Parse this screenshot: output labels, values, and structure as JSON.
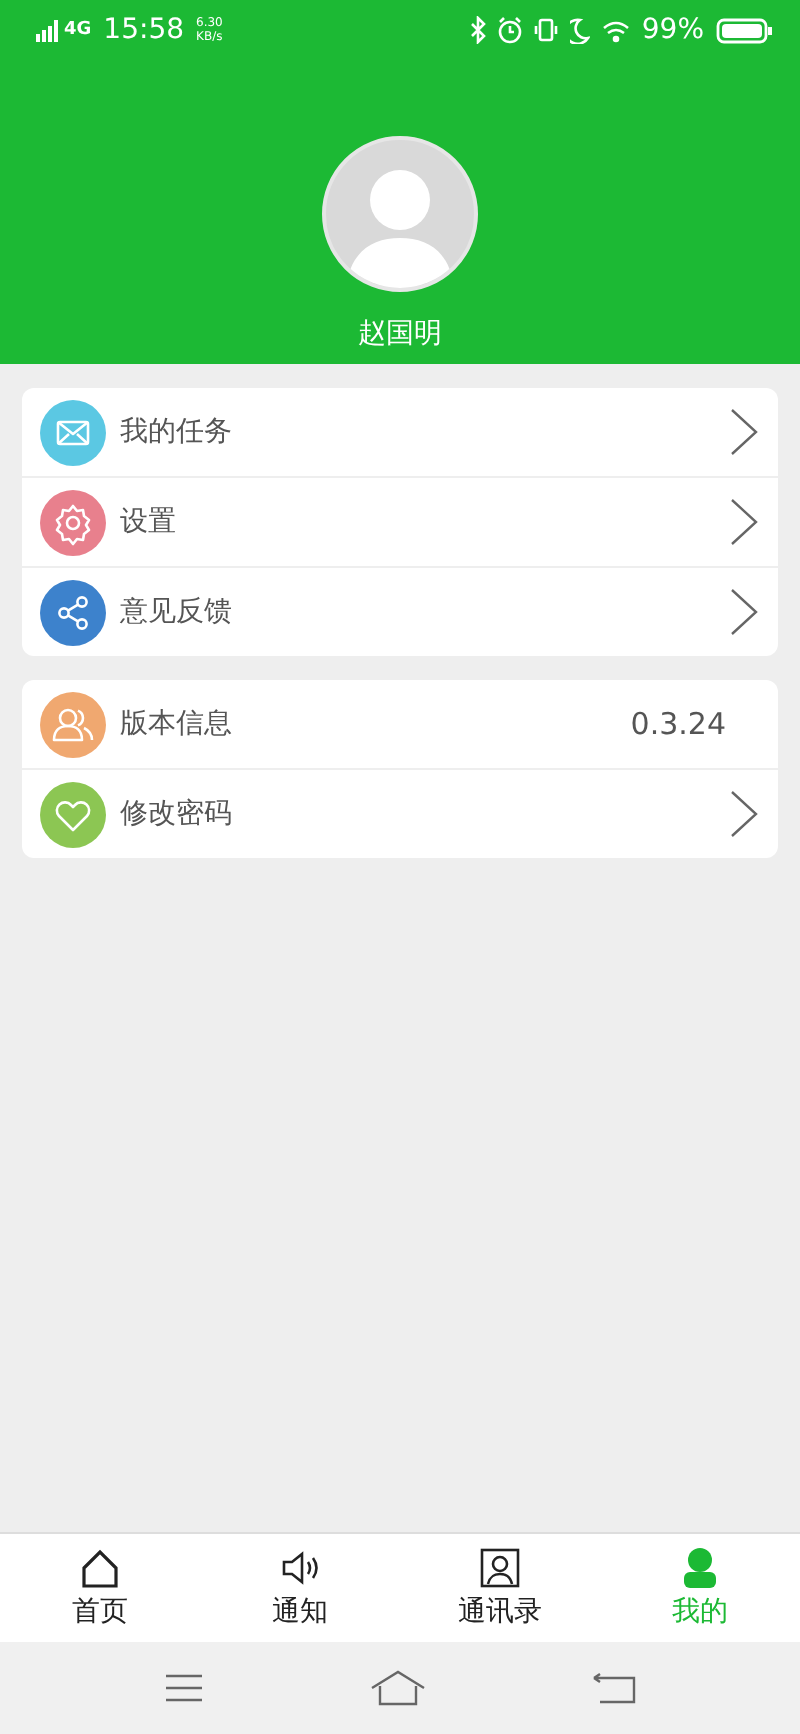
{
  "status_bar": {
    "network": "4G",
    "time": "15:58",
    "speed": "6.30",
    "speed_unit": "KB/s",
    "battery": "99%"
  },
  "profile": {
    "name": "赵国明"
  },
  "menu_groups": [
    {
      "items": [
        {
          "kind": "link",
          "label": "我的任务",
          "color": "#5bc8e3"
        },
        {
          "kind": "link",
          "label": "设置",
          "color": "#e8808d"
        },
        {
          "kind": "link",
          "label": "意见反馈",
          "color": "#3d82cc"
        }
      ]
    },
    {
      "items": [
        {
          "kind": "value",
          "label": "版本信息",
          "value": "0.3.24",
          "color": "#f0a870"
        },
        {
          "kind": "link",
          "label": "修改密码",
          "color": "#8cc653"
        }
      ]
    }
  ],
  "tabs": [
    {
      "label": "首页",
      "selected": false
    },
    {
      "label": "通知",
      "selected": false
    },
    {
      "label": "通讯录",
      "selected": false
    },
    {
      "label": "我的",
      "selected": true
    }
  ]
}
